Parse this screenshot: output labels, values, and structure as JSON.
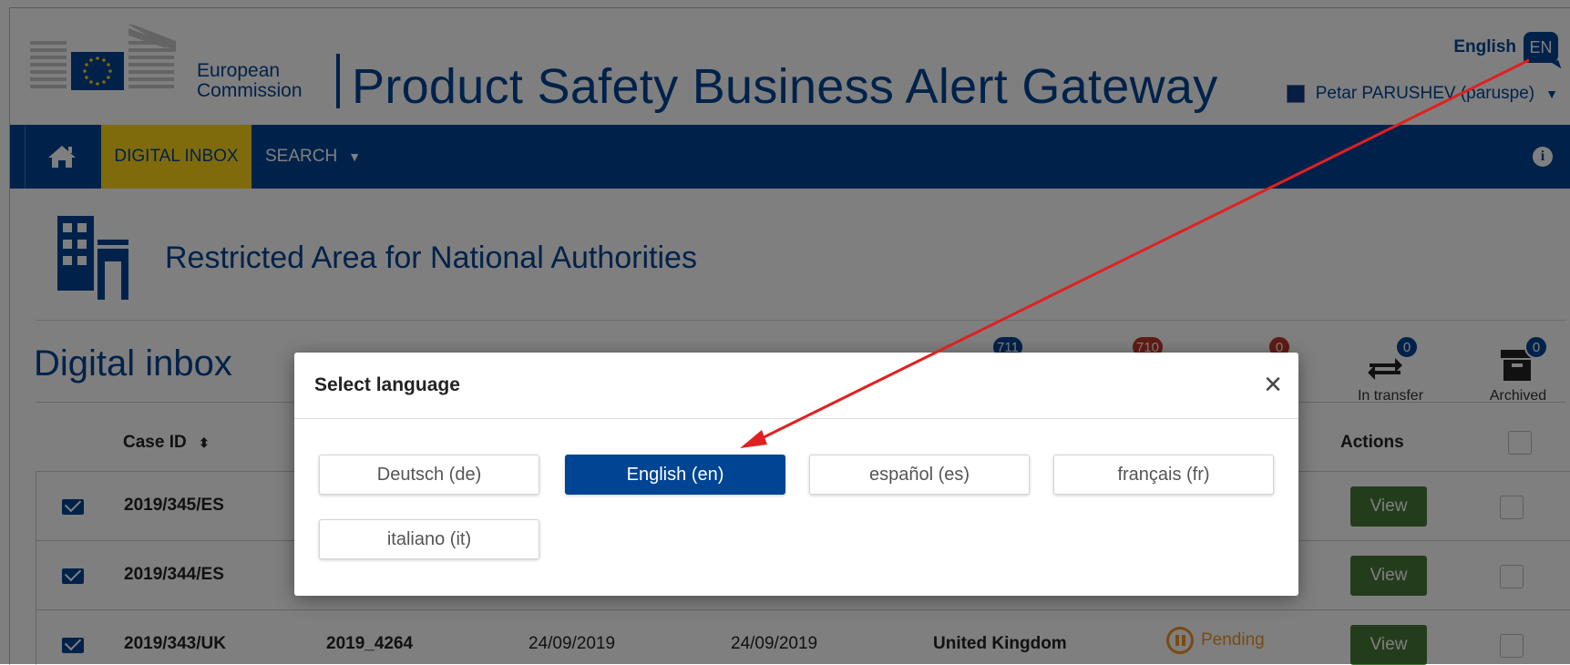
{
  "header": {
    "ec_line1": "European",
    "ec_line2": "Commission",
    "site_title": "Product Safety Business Alert Gateway",
    "language_label": "English",
    "language_code": "EN",
    "user_name": "Petar PARUSHEV (paruspe)"
  },
  "nav": {
    "home_icon": "home-icon",
    "digital_inbox": "DIGITAL INBOX",
    "search": "SEARCH",
    "info_icon": "info-icon"
  },
  "restricted_area": {
    "title": "Restricted Area for National Authorities"
  },
  "inbox": {
    "title": "Digital inbox",
    "counters": [
      {
        "badge": "711"
      },
      {
        "badge": "710"
      },
      {
        "badge": "0"
      },
      {
        "badge": "0",
        "label": "In transfer"
      },
      {
        "badge": "0",
        "label": "Archived"
      }
    ],
    "headers": {
      "case_id": "Case ID",
      "actions": "Actions"
    },
    "rows": [
      {
        "case_id": "2019/345/ES",
        "action": "View"
      },
      {
        "case_id": "2019/344/ES",
        "action": "View"
      },
      {
        "case_id": "2019/343/UK",
        "ref": "2019_4264",
        "date1": "24/09/2019",
        "date2": "24/09/2019",
        "country": "United Kingdom",
        "status": "Pending",
        "action": "View"
      }
    ]
  },
  "modal": {
    "title": "Select language",
    "close": "×",
    "languages": [
      {
        "label": "Deutsch (de)",
        "active": false
      },
      {
        "label": "English (en)",
        "active": true
      },
      {
        "label": "español (es)",
        "active": false
      },
      {
        "label": "français (fr)",
        "active": false
      },
      {
        "label": "italiano (it)",
        "active": false
      }
    ]
  },
  "colors": {
    "ec_blue": "#004494",
    "ec_yellow": "#ffd617",
    "view_green": "#467a39",
    "badge_blue": "#004494",
    "badge_red": "#c0392b",
    "arrow_red": "#e02020",
    "pending_orange": "#f29527"
  }
}
